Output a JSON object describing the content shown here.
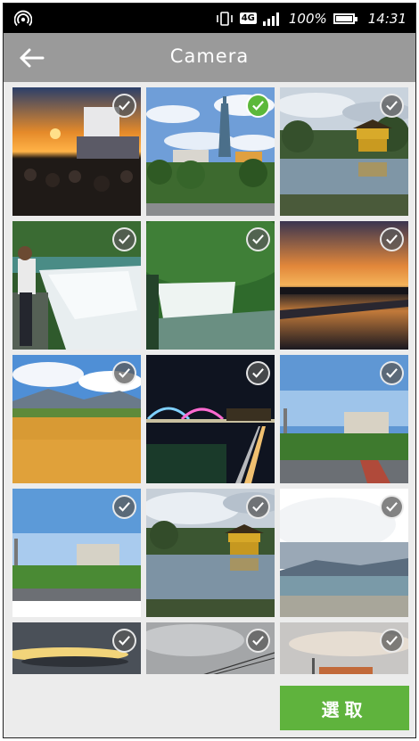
{
  "status_bar": {
    "network": "4G",
    "battery": "100%",
    "time": "14:31",
    "left_icon": "hotspot-icon"
  },
  "header": {
    "title": "Camera",
    "back_icon": "arrow-left-icon"
  },
  "photos": [
    {
      "description_icon": "photo-sunset-stage",
      "selected": false
    },
    {
      "description_icon": "photo-taipei-101",
      "selected": true
    },
    {
      "description_icon": "photo-golden-pavilion",
      "selected": false
    },
    {
      "description_icon": "photo-waterfall-person",
      "selected": false
    },
    {
      "description_icon": "photo-waterfall",
      "selected": false
    },
    {
      "description_icon": "photo-dusk-lake",
      "selected": false
    },
    {
      "description_icon": "photo-flower-field",
      "selected": false
    },
    {
      "description_icon": "photo-night-bridge",
      "selected": false
    },
    {
      "description_icon": "photo-campus-building",
      "selected": false
    },
    {
      "description_icon": "photo-campus-field",
      "selected": false
    },
    {
      "description_icon": "photo-golden-pavilion-2",
      "selected": false
    },
    {
      "description_icon": "photo-cloudy-coast",
      "selected": false
    },
    {
      "description_icon": "photo-cloud-sunset",
      "selected": false
    },
    {
      "description_icon": "photo-overcast-wires",
      "selected": false
    },
    {
      "description_icon": "photo-evening-sky",
      "selected": false
    }
  ],
  "actions": {
    "select_label": "選取"
  },
  "colors": {
    "header_bg": "#9a9a9a",
    "accent_green": "#5fb33d",
    "status_bar_bg": "#000000"
  }
}
